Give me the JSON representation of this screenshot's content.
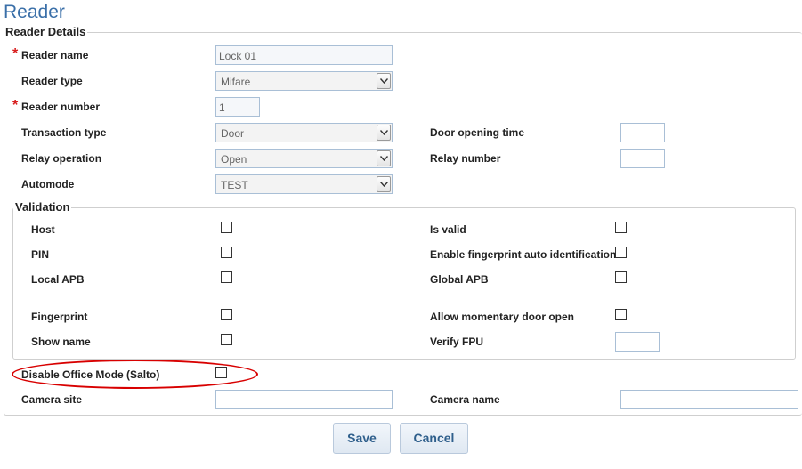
{
  "page": {
    "title": "Reader"
  },
  "reader_details": {
    "legend": "Reader Details",
    "reader_name": {
      "label": "Reader name",
      "value": "Lock 01"
    },
    "reader_type": {
      "label": "Reader type",
      "value": "Mifare"
    },
    "reader_number": {
      "label": "Reader number",
      "value": "1"
    },
    "transaction_type": {
      "label": "Transaction type",
      "value": "Door"
    },
    "relay_operation": {
      "label": "Relay operation",
      "value": "Open"
    },
    "automode": {
      "label": "Automode",
      "value": "TEST"
    },
    "door_opening_time": {
      "label": "Door opening time",
      "value": ""
    },
    "relay_number": {
      "label": "Relay number",
      "value": ""
    },
    "required_mark": "*"
  },
  "validation": {
    "legend": "Validation",
    "host": {
      "label": "Host",
      "checked": false
    },
    "pin": {
      "label": "PIN",
      "checked": false
    },
    "local_apb": {
      "label": "Local APB",
      "checked": false
    },
    "fingerprint": {
      "label": "Fingerprint",
      "checked": false
    },
    "show_name": {
      "label": "Show name",
      "checked": false
    },
    "is_valid": {
      "label": "Is valid",
      "checked": false
    },
    "enable_fingerprint_auto": {
      "label": "Enable fingerprint auto identification",
      "checked": false
    },
    "global_apb": {
      "label": "Global APB",
      "checked": false
    },
    "allow_momentary": {
      "label": "Allow momentary door open",
      "checked": false
    },
    "verify_fpu": {
      "label": "Verify FPU",
      "value": ""
    }
  },
  "office_mode": {
    "label": "Disable Office Mode (Salto)",
    "checked": false
  },
  "camera": {
    "site": {
      "label": "Camera site",
      "value": ""
    },
    "name": {
      "label": "Camera name",
      "value": ""
    }
  },
  "actions": {
    "save": "Save",
    "cancel": "Cancel"
  },
  "colors": {
    "title": "#3a6fa8",
    "required": "#d81e1e",
    "annotation": "#d80000",
    "input_border": "#a9bfd6",
    "button_text": "#2f5f8c"
  }
}
